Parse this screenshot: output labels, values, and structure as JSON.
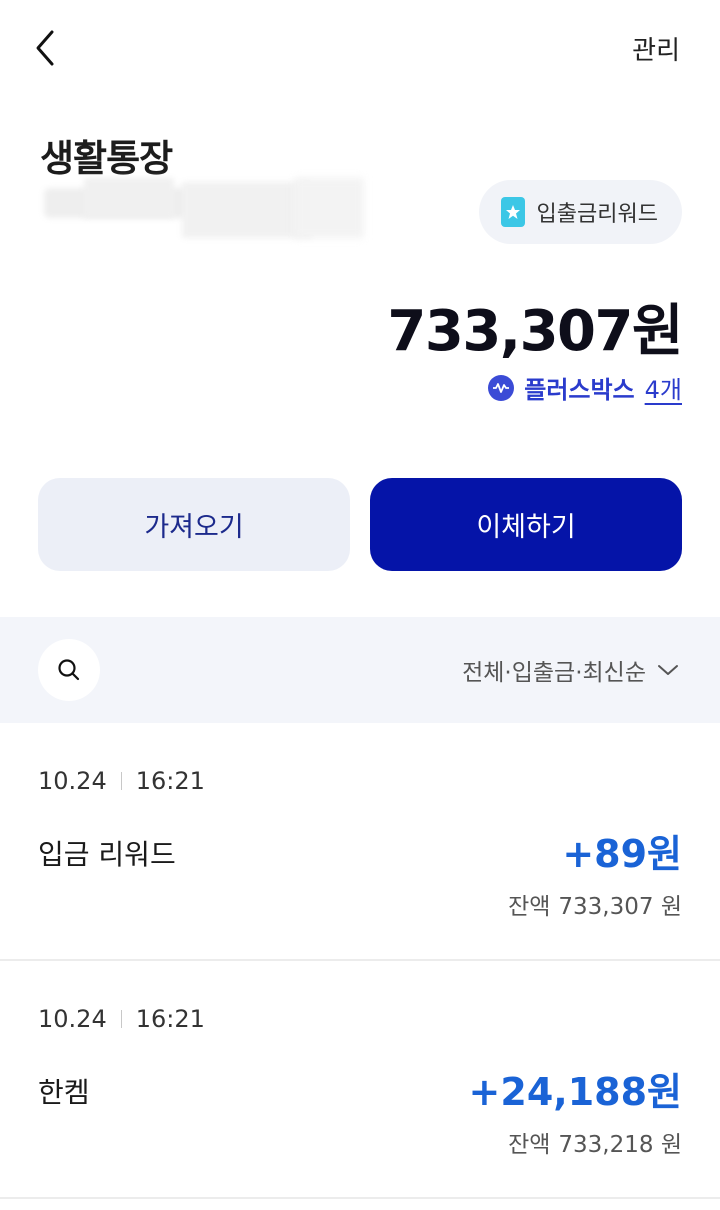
{
  "header": {
    "back_icon": "chevron-left-icon",
    "manage_label": "관리"
  },
  "account": {
    "title": "생활통장",
    "reward_chip_label": "입출금리워드",
    "reward_chip_icon": "star-icon",
    "balance": "733,307원",
    "plusbox_label": "플러스박스",
    "plusbox_count": "4개"
  },
  "actions": {
    "fetch_label": "가져오기",
    "transfer_label": "이체하기"
  },
  "filter": {
    "search_icon": "search-icon",
    "label": "전체·입출금·최신순"
  },
  "transactions": [
    {
      "date": "10.24",
      "time": "16:21",
      "desc": "입금 리워드",
      "amount": "+89원",
      "balance_label": "잔액",
      "balance": "733,307 원"
    },
    {
      "date": "10.24",
      "time": "16:21",
      "desc": "한켐",
      "amount": "+24,188원",
      "balance_label": "잔액",
      "balance": "733,218 원"
    }
  ],
  "colors": {
    "primary": "#0514a8",
    "accent_blue": "#1a63d6",
    "reward_chip_bg": "#f1f3f8",
    "filter_bg": "#f3f5fa"
  }
}
